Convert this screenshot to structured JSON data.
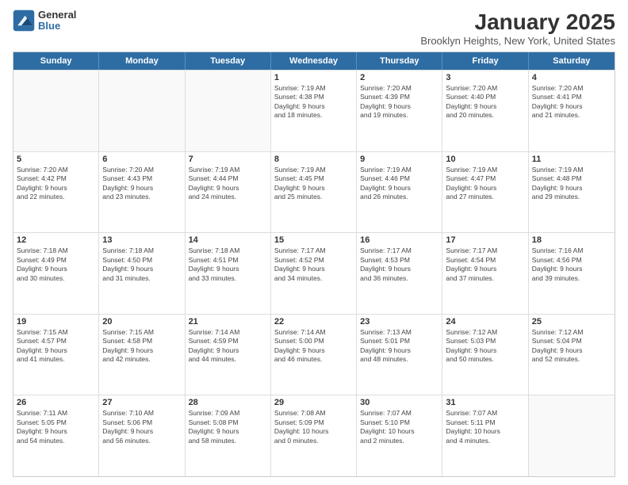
{
  "logo": {
    "general": "General",
    "blue": "Blue"
  },
  "header": {
    "title": "January 2025",
    "subtitle": "Brooklyn Heights, New York, United States"
  },
  "weekdays": [
    "Sunday",
    "Monday",
    "Tuesday",
    "Wednesday",
    "Thursday",
    "Friday",
    "Saturday"
  ],
  "weeks": [
    [
      {
        "day": "",
        "info": ""
      },
      {
        "day": "",
        "info": ""
      },
      {
        "day": "",
        "info": ""
      },
      {
        "day": "1",
        "info": "Sunrise: 7:19 AM\nSunset: 4:38 PM\nDaylight: 9 hours\nand 18 minutes."
      },
      {
        "day": "2",
        "info": "Sunrise: 7:20 AM\nSunset: 4:39 PM\nDaylight: 9 hours\nand 19 minutes."
      },
      {
        "day": "3",
        "info": "Sunrise: 7:20 AM\nSunset: 4:40 PM\nDaylight: 9 hours\nand 20 minutes."
      },
      {
        "day": "4",
        "info": "Sunrise: 7:20 AM\nSunset: 4:41 PM\nDaylight: 9 hours\nand 21 minutes."
      }
    ],
    [
      {
        "day": "5",
        "info": "Sunrise: 7:20 AM\nSunset: 4:42 PM\nDaylight: 9 hours\nand 22 minutes."
      },
      {
        "day": "6",
        "info": "Sunrise: 7:20 AM\nSunset: 4:43 PM\nDaylight: 9 hours\nand 23 minutes."
      },
      {
        "day": "7",
        "info": "Sunrise: 7:19 AM\nSunset: 4:44 PM\nDaylight: 9 hours\nand 24 minutes."
      },
      {
        "day": "8",
        "info": "Sunrise: 7:19 AM\nSunset: 4:45 PM\nDaylight: 9 hours\nand 25 minutes."
      },
      {
        "day": "9",
        "info": "Sunrise: 7:19 AM\nSunset: 4:46 PM\nDaylight: 9 hours\nand 26 minutes."
      },
      {
        "day": "10",
        "info": "Sunrise: 7:19 AM\nSunset: 4:47 PM\nDaylight: 9 hours\nand 27 minutes."
      },
      {
        "day": "11",
        "info": "Sunrise: 7:19 AM\nSunset: 4:48 PM\nDaylight: 9 hours\nand 29 minutes."
      }
    ],
    [
      {
        "day": "12",
        "info": "Sunrise: 7:18 AM\nSunset: 4:49 PM\nDaylight: 9 hours\nand 30 minutes."
      },
      {
        "day": "13",
        "info": "Sunrise: 7:18 AM\nSunset: 4:50 PM\nDaylight: 9 hours\nand 31 minutes."
      },
      {
        "day": "14",
        "info": "Sunrise: 7:18 AM\nSunset: 4:51 PM\nDaylight: 9 hours\nand 33 minutes."
      },
      {
        "day": "15",
        "info": "Sunrise: 7:17 AM\nSunset: 4:52 PM\nDaylight: 9 hours\nand 34 minutes."
      },
      {
        "day": "16",
        "info": "Sunrise: 7:17 AM\nSunset: 4:53 PM\nDaylight: 9 hours\nand 36 minutes."
      },
      {
        "day": "17",
        "info": "Sunrise: 7:17 AM\nSunset: 4:54 PM\nDaylight: 9 hours\nand 37 minutes."
      },
      {
        "day": "18",
        "info": "Sunrise: 7:16 AM\nSunset: 4:56 PM\nDaylight: 9 hours\nand 39 minutes."
      }
    ],
    [
      {
        "day": "19",
        "info": "Sunrise: 7:15 AM\nSunset: 4:57 PM\nDaylight: 9 hours\nand 41 minutes."
      },
      {
        "day": "20",
        "info": "Sunrise: 7:15 AM\nSunset: 4:58 PM\nDaylight: 9 hours\nand 42 minutes."
      },
      {
        "day": "21",
        "info": "Sunrise: 7:14 AM\nSunset: 4:59 PM\nDaylight: 9 hours\nand 44 minutes."
      },
      {
        "day": "22",
        "info": "Sunrise: 7:14 AM\nSunset: 5:00 PM\nDaylight: 9 hours\nand 46 minutes."
      },
      {
        "day": "23",
        "info": "Sunrise: 7:13 AM\nSunset: 5:01 PM\nDaylight: 9 hours\nand 48 minutes."
      },
      {
        "day": "24",
        "info": "Sunrise: 7:12 AM\nSunset: 5:03 PM\nDaylight: 9 hours\nand 50 minutes."
      },
      {
        "day": "25",
        "info": "Sunrise: 7:12 AM\nSunset: 5:04 PM\nDaylight: 9 hours\nand 52 minutes."
      }
    ],
    [
      {
        "day": "26",
        "info": "Sunrise: 7:11 AM\nSunset: 5:05 PM\nDaylight: 9 hours\nand 54 minutes."
      },
      {
        "day": "27",
        "info": "Sunrise: 7:10 AM\nSunset: 5:06 PM\nDaylight: 9 hours\nand 56 minutes."
      },
      {
        "day": "28",
        "info": "Sunrise: 7:09 AM\nSunset: 5:08 PM\nDaylight: 9 hours\nand 58 minutes."
      },
      {
        "day": "29",
        "info": "Sunrise: 7:08 AM\nSunset: 5:09 PM\nDaylight: 10 hours\nand 0 minutes."
      },
      {
        "day": "30",
        "info": "Sunrise: 7:07 AM\nSunset: 5:10 PM\nDaylight: 10 hours\nand 2 minutes."
      },
      {
        "day": "31",
        "info": "Sunrise: 7:07 AM\nSunset: 5:11 PM\nDaylight: 10 hours\nand 4 minutes."
      },
      {
        "day": "",
        "info": ""
      }
    ]
  ]
}
